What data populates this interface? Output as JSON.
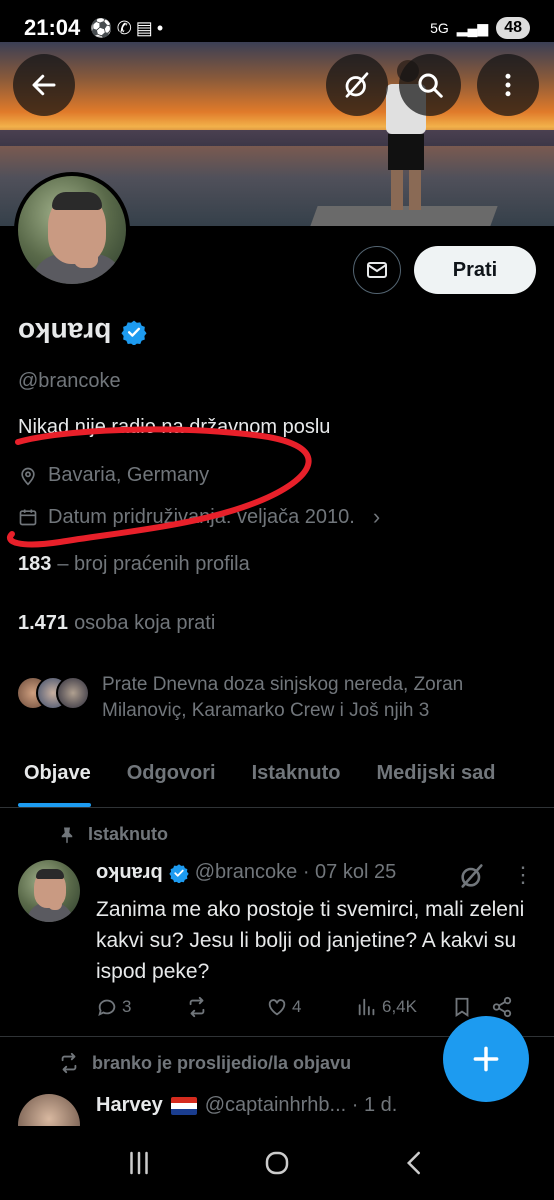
{
  "status_bar": {
    "time": "21:04",
    "network": "5G",
    "battery": "48"
  },
  "profile": {
    "display_name": "branko",
    "handle": "@brancoke",
    "bio": "Nikad nije radio na državnom poslu",
    "location": "Bavaria, Germany",
    "joined": "Datum pridruživanja: veljača 2010.",
    "following_count": "183",
    "following_label": "– broj praćenih profila",
    "followers_count": "1.471",
    "followers_label": "osoba koja prati",
    "known_followers_text": "Prate Dnevna doza sinjskog nereda, Zoran Milanoviç, Karamarko Crew i Još njih 3",
    "follow_button": "Prati"
  },
  "tabs": [
    {
      "label": "Objave",
      "active": true
    },
    {
      "label": "Odgovori",
      "active": false
    },
    {
      "label": "Istaknuto",
      "active": false
    },
    {
      "label": "Medijski sad",
      "active": false
    }
  ],
  "pinned_tweet": {
    "pinned_label": "Istaknuto",
    "author": "branko",
    "meta": "@brancoke · 07 kol 25",
    "text": "Zanima me ako postoje ti svemirci, mali zeleni kakvi su? Jesu li bolji od janjetine? A kakvi su ispod peke?",
    "replies": "3",
    "reposts": "",
    "likes": "4",
    "views": "6,4K"
  },
  "repost_tweet": {
    "repost_label": "branko je proslijedio/la objavu",
    "author": "Harvey",
    "meta": "@captainhrhb... · 1 d."
  },
  "colors": {
    "accent": "#1d9bf0",
    "background": "#000000",
    "muted": "#71767b",
    "annotation": "#e8202a"
  },
  "icons": [
    "back-arrow-icon",
    "grok-icon",
    "search-icon",
    "more-vertical-icon",
    "mail-icon",
    "verified-badge-icon",
    "location-pin-icon",
    "calendar-icon",
    "pin-icon",
    "reply-icon",
    "repost-icon",
    "like-icon",
    "views-icon",
    "bookmark-icon",
    "share-icon",
    "plus-icon"
  ]
}
